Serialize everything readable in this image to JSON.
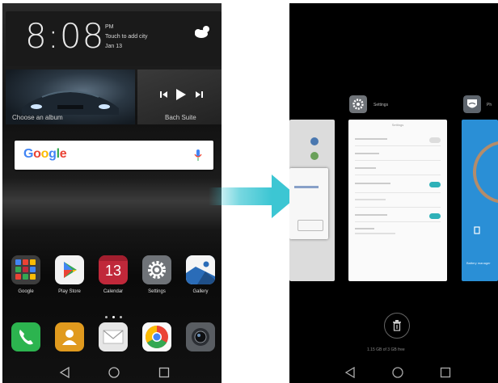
{
  "home": {
    "clock": "8:08",
    "weather": {
      "ampm": "PM",
      "hint": "Touch to add city",
      "date": "Jan 13",
      "icon": "partly-cloudy-icon"
    },
    "music": {
      "album_label": "Choose an album",
      "song": "Bach Suite"
    },
    "search": {
      "logo": "Google"
    },
    "apps": [
      {
        "label": "Google",
        "icon": "google-folder-icon"
      },
      {
        "label": "Play Store",
        "icon": "play-store-icon"
      },
      {
        "label": "Calendar",
        "icon": "calendar-icon",
        "number": "13"
      },
      {
        "label": "Settings",
        "icon": "settings-gear-icon"
      },
      {
        "label": "Gallery",
        "icon": "gallery-icon"
      }
    ],
    "dock": [
      {
        "icon": "phone-icon"
      },
      {
        "icon": "contacts-icon"
      },
      {
        "icon": "messages-icon"
      },
      {
        "icon": "chrome-icon"
      },
      {
        "icon": "camera-icon"
      }
    ],
    "page_indicator": {
      "count": 3,
      "active": 1
    }
  },
  "recents": {
    "cards": [
      {
        "title": "Settings",
        "icon": "settings-icon"
      },
      {
        "title": "Ph",
        "icon": "phone-manager-icon"
      }
    ],
    "memory_text": "1.15 GB of 3 GB free",
    "battery_label": "Battery manager",
    "settings_panel_title": "Settings"
  },
  "colors": {
    "arrow": "#3cc6d3",
    "toggle": "#2fb1b8",
    "calendar": "#c0283a"
  }
}
